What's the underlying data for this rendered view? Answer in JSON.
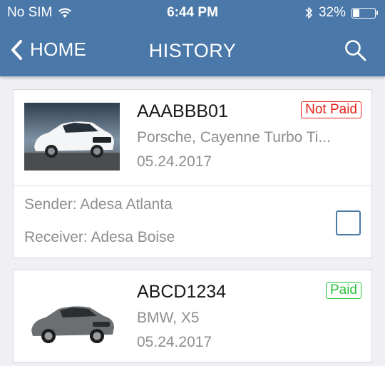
{
  "status_bar": {
    "carrier": "No SIM",
    "time": "6:44 PM",
    "battery_percent": "32%",
    "battery_level": 0.32,
    "wifi_icon": "wifi-icon",
    "bluetooth_icon": "bluetooth-icon"
  },
  "nav": {
    "back_label": "HOME",
    "title": "HISTORY",
    "search_icon": "search-icon"
  },
  "colors": {
    "bar": "#4a78a8",
    "not_paid": "#e0221c",
    "paid": "#27c23b",
    "checkbox": "#4a78a8"
  },
  "items": [
    {
      "code": "AAABBB01",
      "status": "Not Paid",
      "model": "Porsche, Cayenne Turbo Ti...",
      "date": "05.24.2017",
      "sender": "Sender: Adesa Atlanta",
      "receiver": "Receiver: Adesa Boise",
      "image": "white-porsche-suv"
    },
    {
      "code": "ABCD1234",
      "status": "Paid",
      "model": "BMW, X5",
      "date": "05.24.2017",
      "image": "grey-bmw-suv"
    }
  ]
}
